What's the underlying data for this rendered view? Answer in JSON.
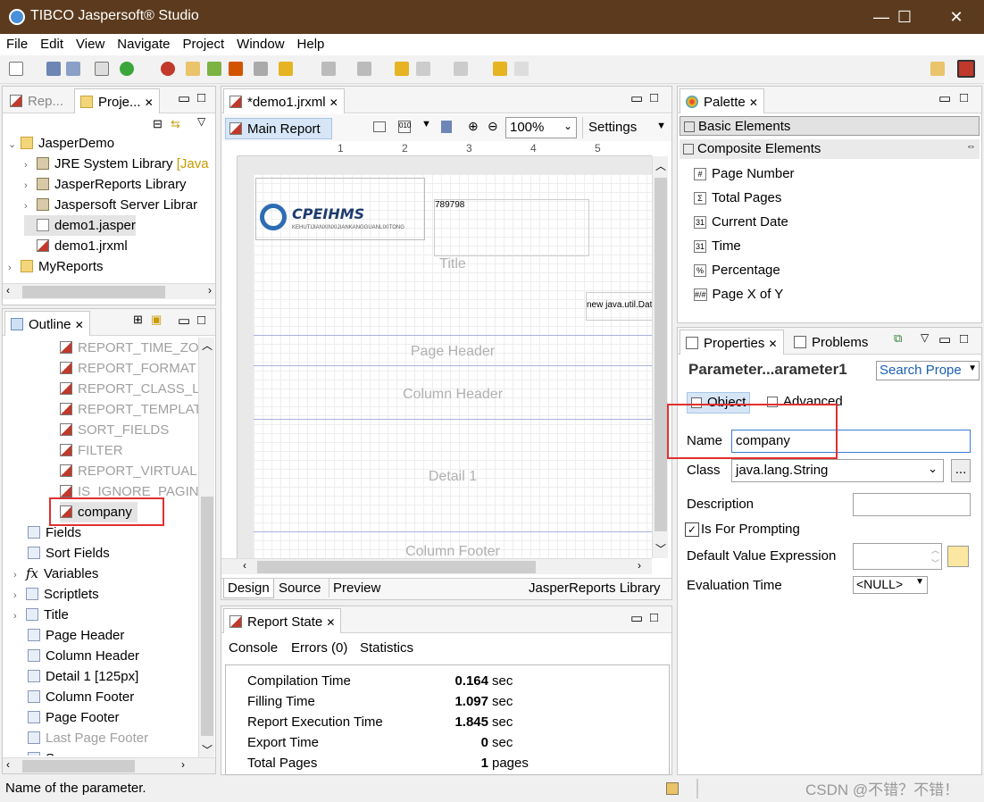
{
  "app": {
    "title": "TIBCO Jaspersoft® Studio",
    "minimize": "—",
    "maximize": "☐",
    "close": "✕"
  },
  "menu": [
    "File",
    "Edit",
    "View",
    "Navigate",
    "Project",
    "Window",
    "Help"
  ],
  "left_top": {
    "tabs": [
      "Rep...",
      "Proje..."
    ],
    "tree": [
      {
        "label": "JasperDemo",
        "level": 0,
        "icon": "folder",
        "caret": "⌄"
      },
      {
        "label": "JRE System Library",
        "suffix": " [Java",
        "level": 1,
        "icon": "jar",
        "caret": "›"
      },
      {
        "label": "JasperReports Library",
        "level": 1,
        "icon": "jar",
        "caret": "›"
      },
      {
        "label": "Jaspersoft Server Librar",
        "level": 1,
        "icon": "jar",
        "caret": "›"
      },
      {
        "label": "demo1.jasper",
        "level": 1,
        "icon": "file",
        "caret": ""
      },
      {
        "label": "demo1.jrxml",
        "level": 1,
        "icon": "rep",
        "caret": ""
      },
      {
        "label": "MyReports",
        "level": 0,
        "icon": "folder",
        "caret": "›"
      }
    ]
  },
  "outline": {
    "tab": "Outline",
    "items": [
      {
        "label": "REPORT_TIME_ZO",
        "gray": true,
        "icon": "rep",
        "caret": ""
      },
      {
        "label": "REPORT_FORMAT",
        "gray": true,
        "icon": "rep",
        "caret": ""
      },
      {
        "label": "REPORT_CLASS_L(",
        "gray": true,
        "icon": "rep",
        "caret": ""
      },
      {
        "label": "REPORT_TEMPLAT",
        "gray": true,
        "icon": "rep",
        "caret": ""
      },
      {
        "label": "SORT_FIELDS",
        "gray": true,
        "icon": "rep",
        "caret": ""
      },
      {
        "label": "FILTER",
        "gray": true,
        "icon": "rep",
        "caret": ""
      },
      {
        "label": "REPORT_VIRTUALI",
        "gray": true,
        "icon": "rep",
        "caret": ""
      },
      {
        "label": "IS_IGNORE_PAGIN",
        "gray": true,
        "icon": "rep",
        "caret": ""
      },
      {
        "label": "company",
        "gray": false,
        "icon": "rep",
        "caret": "",
        "indent": 1
      },
      {
        "label": "Fields",
        "gray": false,
        "icon": "band",
        "caret": "",
        "indent": 0
      },
      {
        "label": "Sort Fields",
        "gray": false,
        "icon": "band",
        "caret": "",
        "indent": 0
      },
      {
        "label": "Variables",
        "gray": false,
        "icon": "fx",
        "caret": "›",
        "indent": 0
      },
      {
        "label": "Scriptlets",
        "gray": false,
        "icon": "band",
        "caret": "›",
        "indent": 0
      },
      {
        "label": "Title",
        "gray": false,
        "icon": "band",
        "caret": "›",
        "indent": 0
      },
      {
        "label": "Page Header",
        "gray": false,
        "icon": "band",
        "caret": "",
        "indent": 0
      },
      {
        "label": "Column Header",
        "gray": false,
        "icon": "band",
        "caret": "",
        "indent": 0
      },
      {
        "label": "Detail 1 [125px]",
        "gray": false,
        "icon": "band",
        "caret": "",
        "indent": 0
      },
      {
        "label": "Column Footer",
        "gray": false,
        "icon": "band",
        "caret": "",
        "indent": 0
      },
      {
        "label": "Page Footer",
        "gray": false,
        "icon": "band",
        "caret": "",
        "indent": 0
      },
      {
        "label": "Last Page Footer",
        "gray": true,
        "icon": "band",
        "caret": "",
        "indent": 0
      },
      {
        "label": "Summary",
        "gray": false,
        "icon": "band",
        "caret": "",
        "indent": 0
      }
    ]
  },
  "editor": {
    "tab": "*demo1.jrxml",
    "main_report": "Main Report",
    "zoom": "100%",
    "settings": "Settings",
    "ruler": [
      "1",
      "2",
      "3",
      "4",
      "5"
    ],
    "logo_text": "CPEIHMS",
    "logo_sub": "KEHUTIJIANXINXIJIANKANGGUANLIXITONG",
    "field_text": "789798",
    "date_text": "new java.util.Dat",
    "bands": [
      "Title",
      "Page Header",
      "Column Header",
      "Detail 1",
      "Column Footer"
    ],
    "bottom_tabs": [
      "Design",
      "Source",
      "Preview"
    ],
    "library": "JasperReports Library"
  },
  "report_state": {
    "tab": "Report State",
    "subtabs": [
      "Console",
      "Errors (0)",
      "Statistics"
    ],
    "stats": [
      {
        "label": "Compilation Time",
        "value": "0.164",
        "unit": "sec"
      },
      {
        "label": "Filling Time",
        "value": "1.097",
        "unit": "sec"
      },
      {
        "label": "Report Execution Time",
        "value": "1.845",
        "unit": "sec"
      },
      {
        "label": "Export Time",
        "value": "0",
        "unit": "sec"
      },
      {
        "label": "Total Pages",
        "value": "1",
        "unit": "pages"
      }
    ]
  },
  "palette": {
    "tab": "Palette",
    "sections": [
      "Basic Elements",
      "Composite Elements"
    ],
    "items": [
      {
        "label": "Page Number",
        "icon": "#"
      },
      {
        "label": "Total Pages",
        "icon": "Σ"
      },
      {
        "label": "Current Date",
        "icon": "31"
      },
      {
        "label": "Time",
        "icon": "31"
      },
      {
        "label": "Percentage",
        "icon": "%"
      },
      {
        "label": "Page X of Y",
        "icon": "#/#"
      }
    ]
  },
  "properties": {
    "tabs": [
      "Properties",
      "Problems"
    ],
    "header": "Parameter...arameter1",
    "search": "Search Prope",
    "subtabs": [
      "Object",
      "Advanced"
    ],
    "name_label": "Name",
    "name_value": "company",
    "class_label": "Class",
    "class_value": "java.lang.String",
    "browse": "...",
    "description_label": "Description",
    "description_value": "",
    "prompting_label": "Is For Prompting",
    "prompting_checked": "✓",
    "default_label": "Default Value Expression",
    "eval_label": "Evaluation Time",
    "eval_value": "<NULL>"
  },
  "status": {
    "text": "Name of the parameter.",
    "watermark": "CSDN @不错？不错！"
  }
}
